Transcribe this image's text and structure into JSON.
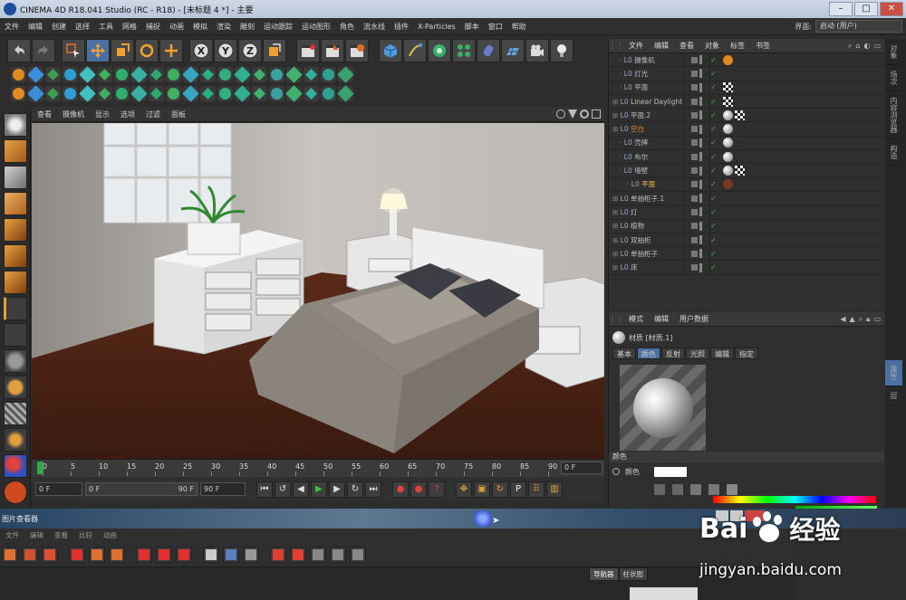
{
  "window": {
    "title": "CINEMA 4D R18.041 Studio (RC - R18) - [未标题 4 *] - 主要",
    "min": "–",
    "max": "□",
    "close": "✕"
  },
  "menu": [
    "文件",
    "编辑",
    "创建",
    "选择",
    "工具",
    "网格",
    "捕捉",
    "动画",
    "模拟",
    "渲染",
    "雕刻",
    "运动跟踪",
    "运动图形",
    "角色",
    "流水线",
    "插件",
    "X-Particles",
    "脚本",
    "窗口",
    "帮助"
  ],
  "layout": {
    "label": "界面:",
    "value": "启动 (用户)"
  },
  "toolbar": {
    "undo": "undo-icon",
    "axis_x": "X",
    "axis_y": "Y",
    "axis_z": "Z"
  },
  "viewport": {
    "menu": [
      "查看",
      "摄像机",
      "显示",
      "选项",
      "过滤",
      "面板"
    ],
    "icons": [
      "move-view-icon",
      "zoom-view-icon",
      "rotate-view-icon",
      "layout-icon"
    ]
  },
  "timeline": {
    "ticks": [
      "0",
      "5",
      "10",
      "15",
      "20",
      "25",
      "30",
      "35",
      "40",
      "45",
      "50",
      "55",
      "60",
      "65",
      "70",
      "75",
      "80",
      "85",
      "90"
    ],
    "end_field": "0 F"
  },
  "transport": {
    "current_frame": "0 F",
    "range_start": "0 F",
    "range_end": "90 F",
    "max_frame": "90 F"
  },
  "object_manager": {
    "menu": [
      "文件",
      "编辑",
      "查看",
      "对象",
      "标签",
      "书签"
    ],
    "rows": [
      {
        "name": "摄像机",
        "indent": 1,
        "color": "#bdbdbd"
      },
      {
        "name": "灯光",
        "indent": 1,
        "color": "#bdbdbd"
      },
      {
        "name": "平面",
        "indent": 1,
        "color": "#bdbdbd"
      },
      {
        "name": "Linear Daylight",
        "indent": 0,
        "color": "#bdbdbd"
      },
      {
        "name": "平面.2",
        "indent": 0,
        "color": "#bdbdbd"
      },
      {
        "name": "空白",
        "indent": 0,
        "color": "#e08a3a"
      },
      {
        "name": "壳牌",
        "indent": 1,
        "color": "#bdbdbd"
      },
      {
        "name": "布尔",
        "indent": 1,
        "color": "#bdbdbd"
      },
      {
        "name": "墙壁",
        "indent": 1,
        "color": "#bdbdbd"
      },
      {
        "name": "平面",
        "indent": 2,
        "color": "#f0c040"
      },
      {
        "name": "单抽柜子.1",
        "indent": 0,
        "color": "#bdbdbd"
      },
      {
        "name": "灯",
        "indent": 0,
        "color": "#bdbdbd"
      },
      {
        "name": "植物",
        "indent": 0,
        "color": "#bdbdbd"
      },
      {
        "name": "双抽柜",
        "indent": 0,
        "color": "#bdbdbd"
      },
      {
        "name": "单抽柜子",
        "indent": 0,
        "color": "#bdbdbd"
      },
      {
        "name": "床",
        "indent": 0,
        "color": "#bdbdbd"
      }
    ]
  },
  "attribute_manager": {
    "menu": [
      "模式",
      "编辑",
      "用户数据"
    ],
    "material_title": "材质 [材质.1]",
    "tabs": [
      "基本",
      "颜色",
      "反射",
      "光照",
      "编辑",
      "指定"
    ],
    "active_tab": "颜色",
    "section": "颜色",
    "color_label": "颜色"
  },
  "side_tabs": [
    "对象",
    "场次",
    "内容浏览器",
    "构造"
  ],
  "side_tabs_bottom": [
    "属性",
    "层"
  ],
  "picture_viewer": {
    "title": "图片查看器",
    "menu": [
      "文件",
      "编辑",
      "查看",
      "比较",
      "动画"
    ],
    "nav_tabs": [
      "导航器",
      "柱状图"
    ],
    "active_nav": "导航器"
  },
  "watermark": {
    "brand": "Bai",
    "cn": "经验",
    "url": "jingyan.baidu.com"
  },
  "colors": {
    "accent": "#4a6fa3",
    "active_orange": "#e08a3a",
    "bg": "#2d2d2d"
  }
}
